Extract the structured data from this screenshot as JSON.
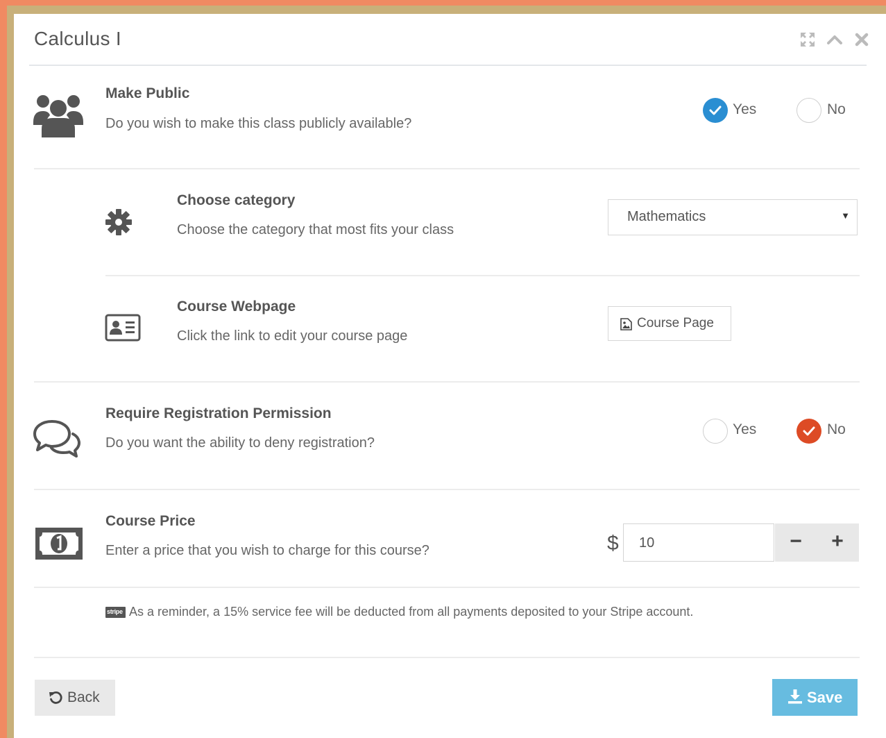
{
  "window": {
    "title": "Calculus I",
    "controls": [
      "expand-icon",
      "collapse-icon",
      "close-icon"
    ]
  },
  "make_public": {
    "title": "Make Public",
    "description": "Do you wish to make this class publicly available?",
    "icon": "users-icon",
    "options": [
      {
        "label": "Yes",
        "selected": true
      },
      {
        "label": "No",
        "selected": false
      }
    ]
  },
  "category": {
    "title": "Choose category",
    "description": "Choose the category that most fits your class",
    "icon": "gear-icon",
    "selected": "Mathematics"
  },
  "webpage": {
    "title": "Course Webpage",
    "description": "Click the link to edit your course page",
    "icon": "id-card-icon",
    "button_label": "Course Page"
  },
  "registration": {
    "title": "Require Registration Permission",
    "description": "Do you want the ability to deny registration?",
    "icon": "comments-icon",
    "options": [
      {
        "label": "Yes",
        "selected": false
      },
      {
        "label": "No",
        "selected": true
      }
    ]
  },
  "price": {
    "title": "Course Price",
    "description": "Enter a price that you wish to charge for this course?",
    "icon": "money-icon",
    "currency": "$",
    "value": "10",
    "decrement_label": "−",
    "increment_label": "+"
  },
  "reminder": {
    "badge": "stripe",
    "text": "As a reminder, a 15% service fee will be deducted from all payments deposited to your Stripe account."
  },
  "footer": {
    "back_label": "Back",
    "save_label": "Save"
  },
  "colors": {
    "accent_blue": "#2a8ed2",
    "accent_orange": "#dd4b25",
    "save_button": "#67bce0",
    "frame_orange": "#f08a62",
    "frame_gold": "#c8b07a"
  }
}
